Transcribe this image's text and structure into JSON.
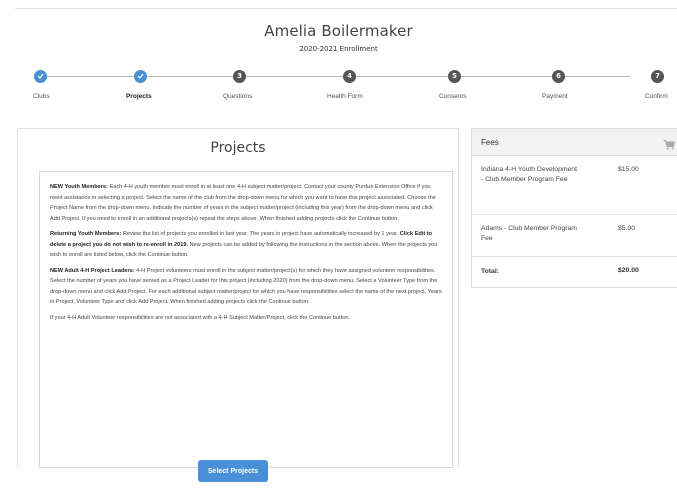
{
  "header": {
    "name": "Amelia Boilermaker",
    "subtitle": "2020-2021 Enrollment"
  },
  "stepper": {
    "steps": [
      {
        "label": "Clubs",
        "number": "",
        "state": "done"
      },
      {
        "label": "Projects",
        "number": "",
        "state": "done"
      },
      {
        "label": "Questions",
        "number": "3",
        "state": "todo"
      },
      {
        "label": "Health Form",
        "number": "4",
        "state": "todo"
      },
      {
        "label": "Consents",
        "number": "5",
        "state": "todo"
      },
      {
        "label": "Payment",
        "number": "6",
        "state": "todo"
      },
      {
        "label": "Confirm",
        "number": "7",
        "state": "todo"
      }
    ]
  },
  "main": {
    "title": "Projects",
    "p1_bold": "NEW Youth Members:",
    "p1_text": " Each 4-H youth member must enroll in at least one 4-H subject matter/project. Contact your county Purdue Extension Office if you need assistance in selecting a project. Select the name of the club from the drop-down menu for which you want to have this project associated. Choose the Project Name from the drop-down menu. Indicate the number of years in the subject matter/project (including this year) from the drop-down menu and click Add Project. If you need to enroll in an additional projects(s) repeat the steps above. When finished adding projects click the Continue button.",
    "p2_bold": "Returning Youth Members:",
    "p2_text1": " Review the list of projects you enrolled in last year. The years in project have automatically increased by 1 year. ",
    "p2_bold2": "Click Edit to delete a project you do not wish to re-enroll in 2019.",
    "p2_text2": " New projects can be added by following the instructions in the section above. When the projects you wish to enroll are listed below, click the Continue button.",
    "p3_bold": "NEW Adult 4-H Project Leaders:",
    "p3_text": " 4-H Project volunteers must enroll in the subject matter/project(s) for which they have assigned volunteer responsibilities. Select the number of years you have served as a Project Leader for this project (including 2020) from the drop-down menu. Select a Volunteer Type from the drop-down menu and click Add Project. For each additional subject matter/project for which you have responsibilities select the name of the next project, Years in Project, Volunteer Type and click Add Project. When finished adding projects click the Continue button.",
    "p4_text": "If your 4-H Adult Volunteer responsibilities are not associated with a 4-H Subject Matter/Project, click the Continue button.",
    "select_button": "Select Projects"
  },
  "fees": {
    "title": "Fees",
    "items": [
      {
        "label": "Indiana 4-H Youth Development - Club Member Program Fee",
        "amount": "$15.00"
      },
      {
        "label": "Adams - Club Member Program Fee",
        "amount": "$5.00"
      }
    ],
    "total_label": "Total:",
    "total_amount": "$20.00"
  },
  "colors": {
    "accent": "#4a90d9",
    "step_done": "#4a8fd4",
    "step_todo": "#555555"
  }
}
